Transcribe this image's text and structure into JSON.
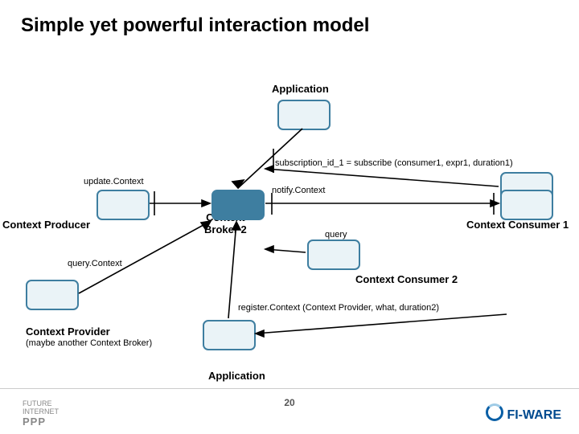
{
  "title": "Simple yet powerful interaction model",
  "labels": {
    "application_top": "Application",
    "application_bottom": "Application",
    "subscribe": "subscription_id_1 = subscribe (consumer1, expr1, duration1)",
    "update": "update.Context",
    "notify": "notify.Context",
    "producer": "Context Producer",
    "broker": "Context\nBroker 2",
    "query_arrow": "query",
    "consumer1": "Context Consumer 1",
    "query_context": "query.Context",
    "consumer2": "Context Consumer 2",
    "register": "register.Context (Context Provider, what, duration2)",
    "provider": "Context Provider",
    "provider_sub": "(maybe another Context Broker)"
  },
  "footer": {
    "page": "20",
    "left_line1": "FUTURE",
    "left_line2": "INTERNET",
    "left_line3": "PPP",
    "right": "FI-WARE"
  }
}
